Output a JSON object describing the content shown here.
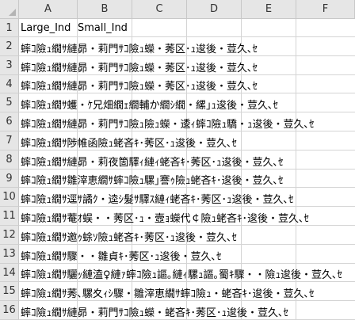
{
  "columns": [
    "A",
    "B",
    "C",
    "D",
    "E",
    "F"
  ],
  "rows": [
    "1",
    "2",
    "3",
    "4",
    "5",
    "6",
    "7",
    "8",
    "9",
    "10",
    "11",
    "12",
    "13",
    "14",
    "15",
    "16"
  ],
  "header_row": {
    "a1": "Large_Ind",
    "b1": "Small_Ind"
  },
  "cells": [
    "蟀ｺ險ｭ繝ｻ縺昴・莉門ｻｺ險ｭ蠑・莠区･ｭ逡後・荳久､ｾ",
    "蟀ｺ險ｭ繝ｻ縺昴・莉門ｻｺ險ｭ蠑・莠区･ｭ逡後・荳久､ｾ",
    "蟀ｺ險ｭ繝ｻ縺昴・莉門ｻｺ險ｭ蠑・莠区･ｭ逡後・荳久､ｾ",
    "蟀ｺ險ｭ繝ｻ蠖・ｹ兄畑繝ｪ繝輔か繝ｼ繝・縲｣ｭ逡後・荳久､ｾ",
    "蟀ｺ險ｭ繝ｻ縺昴・莉門ｻｺ險ｭ險ｭ蠑・逶ｨ蟀ｺ險ｭ驕・ｭ逡後・荳久､ｾ",
    "蟀ｺ險ｭ繝ｻ陟帷函險ｭ蛯吝ｷ･莠区･ｭ逡後・荳久､ｾ",
    "蟀ｺ險ｭ繝ｻ縺昴・莉夜箇驛ｨ縺ｨ蛯吝ｷ･莠区･ｭ逡後・荳久､ｾ",
    "蟀ｺ險ｭ繝ｻ雛滓恵繝ｻ蟀ｺ險ｭ騾｣謇ｩ險ｭ蛯吝ｷ･逡後・荳久､ｾ",
    "蟀ｺ險ｭ繝ｻ逕ｻ譎ｸ・逵ｼ髮ｻ驛ｽ縺ｨ蛯吝ｷ･莠区･ｭ逡後・荳久､ｾ",
    "蟀ｺ險ｭ繝ｻ菴ｵ蜈・・莠区･ｭ・壼ｮ蠑代￠險ｭ蛯吝ｷ･逡後・荳久､ｾ",
    "蟀ｺ險ｭ繝ｻ邀ｩ蜍ｿ險ｭ蛯吝ｷ･莠区･ｭ逡後・荳久､ｾ",
    "蟀ｺ險ｭ繝ｻ驟・・雛貞ｷ･莠区･ｭ逡後・荳久､ｾ",
    "蟀ｺ險ｭ繝ｻ驪ｯ縺溘♀縺ｧ蟀ｺ險ｭ謳｡縺ｨ騾ｭ謳｡蜀ｷ驟・・險ｭ逡後・荳久､ｾ",
    "蟀ｺ險ｭ繝ｻ莠､騾夊ｨｼ驟・雛滓恵繝ｻ蟀ｺ險ｭ・蛯吝ｷ･逡後・荳久､ｾ",
    "蟀ｺ險ｭ繝ｻ縺昴・莉門ｻｺ險ｭ蠑・蛯吝ｷ･莠区･ｭ逡後・荳久､ｾ"
  ]
}
